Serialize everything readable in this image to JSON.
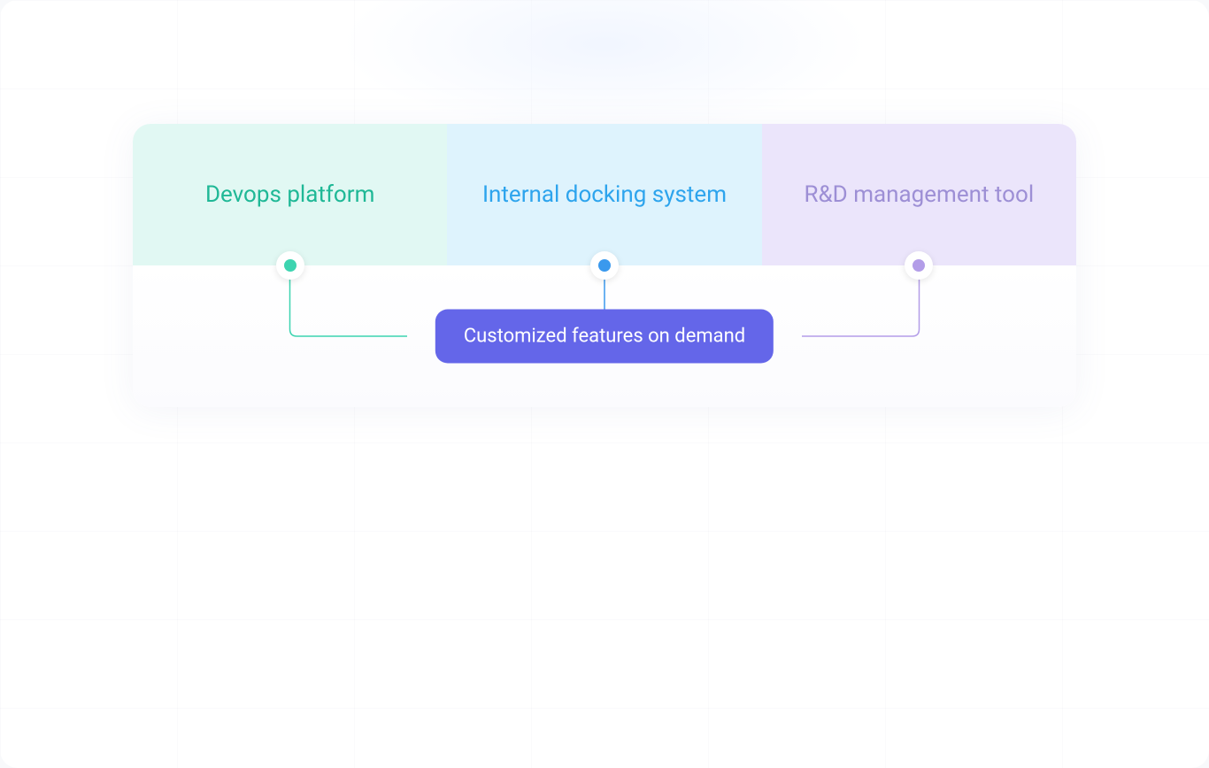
{
  "segments": {
    "devops": {
      "label": "Devops platform",
      "color": "#1fb896",
      "bg": "#e1f8f3"
    },
    "docking": {
      "label": "Internal docking system",
      "color": "#2da4ed",
      "bg": "#def3fd"
    },
    "rd": {
      "label": "R&D management tool",
      "color": "#9d8fd5",
      "bg": "#ebe5fb"
    }
  },
  "center_badge": {
    "label": "Customized features on demand",
    "color": "#6466e9"
  },
  "connectors": {
    "devops_line_color": "#3dd4b0",
    "docking_line_color": "#3a99ed",
    "rd_line_color": "#b39de8"
  }
}
